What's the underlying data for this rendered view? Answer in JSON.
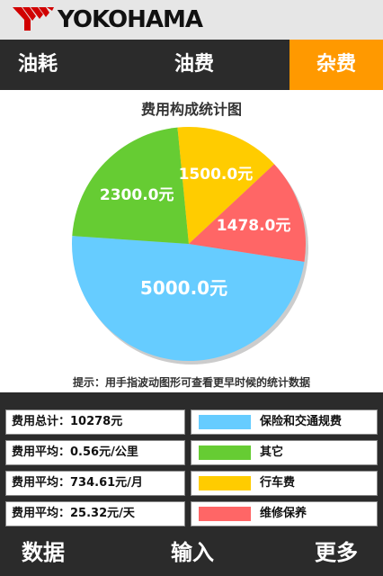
{
  "header": {
    "brand": "YOKOHAMA"
  },
  "tabs": [
    {
      "label": "油耗"
    },
    {
      "label": "油费"
    },
    {
      "label": "杂费"
    }
  ],
  "chart_data": {
    "type": "pie",
    "title": "费用构成统计图",
    "categories": [
      "保险和交通规费",
      "其它",
      "行车费",
      "维修保养"
    ],
    "values": [
      5000.0,
      2300.0,
      1500.0,
      1478.0
    ],
    "data_labels": [
      "5000.0元",
      "2300.0元",
      "1500.0元",
      "1478.0元"
    ],
    "colors": [
      "#66ccff",
      "#66cc33",
      "#ffcc00",
      "#ff6666"
    ]
  },
  "hint": "提示：用手指波动图形可查看更早时候的统计数据",
  "stats": [
    {
      "text": "费用总计：10278元",
      "legend": "保险和交通规费",
      "color": "#66ccff"
    },
    {
      "text": "费用平均：0.56元/公里",
      "legend": "其它",
      "color": "#66cc33"
    },
    {
      "text": "费用平均：734.61元/月",
      "legend": "行车费",
      "color": "#ffcc00"
    },
    {
      "text": "费用平均：25.32元/天",
      "legend": "维修保养",
      "color": "#ff6666"
    }
  ],
  "bottom": [
    {
      "label": "数据"
    },
    {
      "label": "输入"
    },
    {
      "label": "更多"
    }
  ]
}
